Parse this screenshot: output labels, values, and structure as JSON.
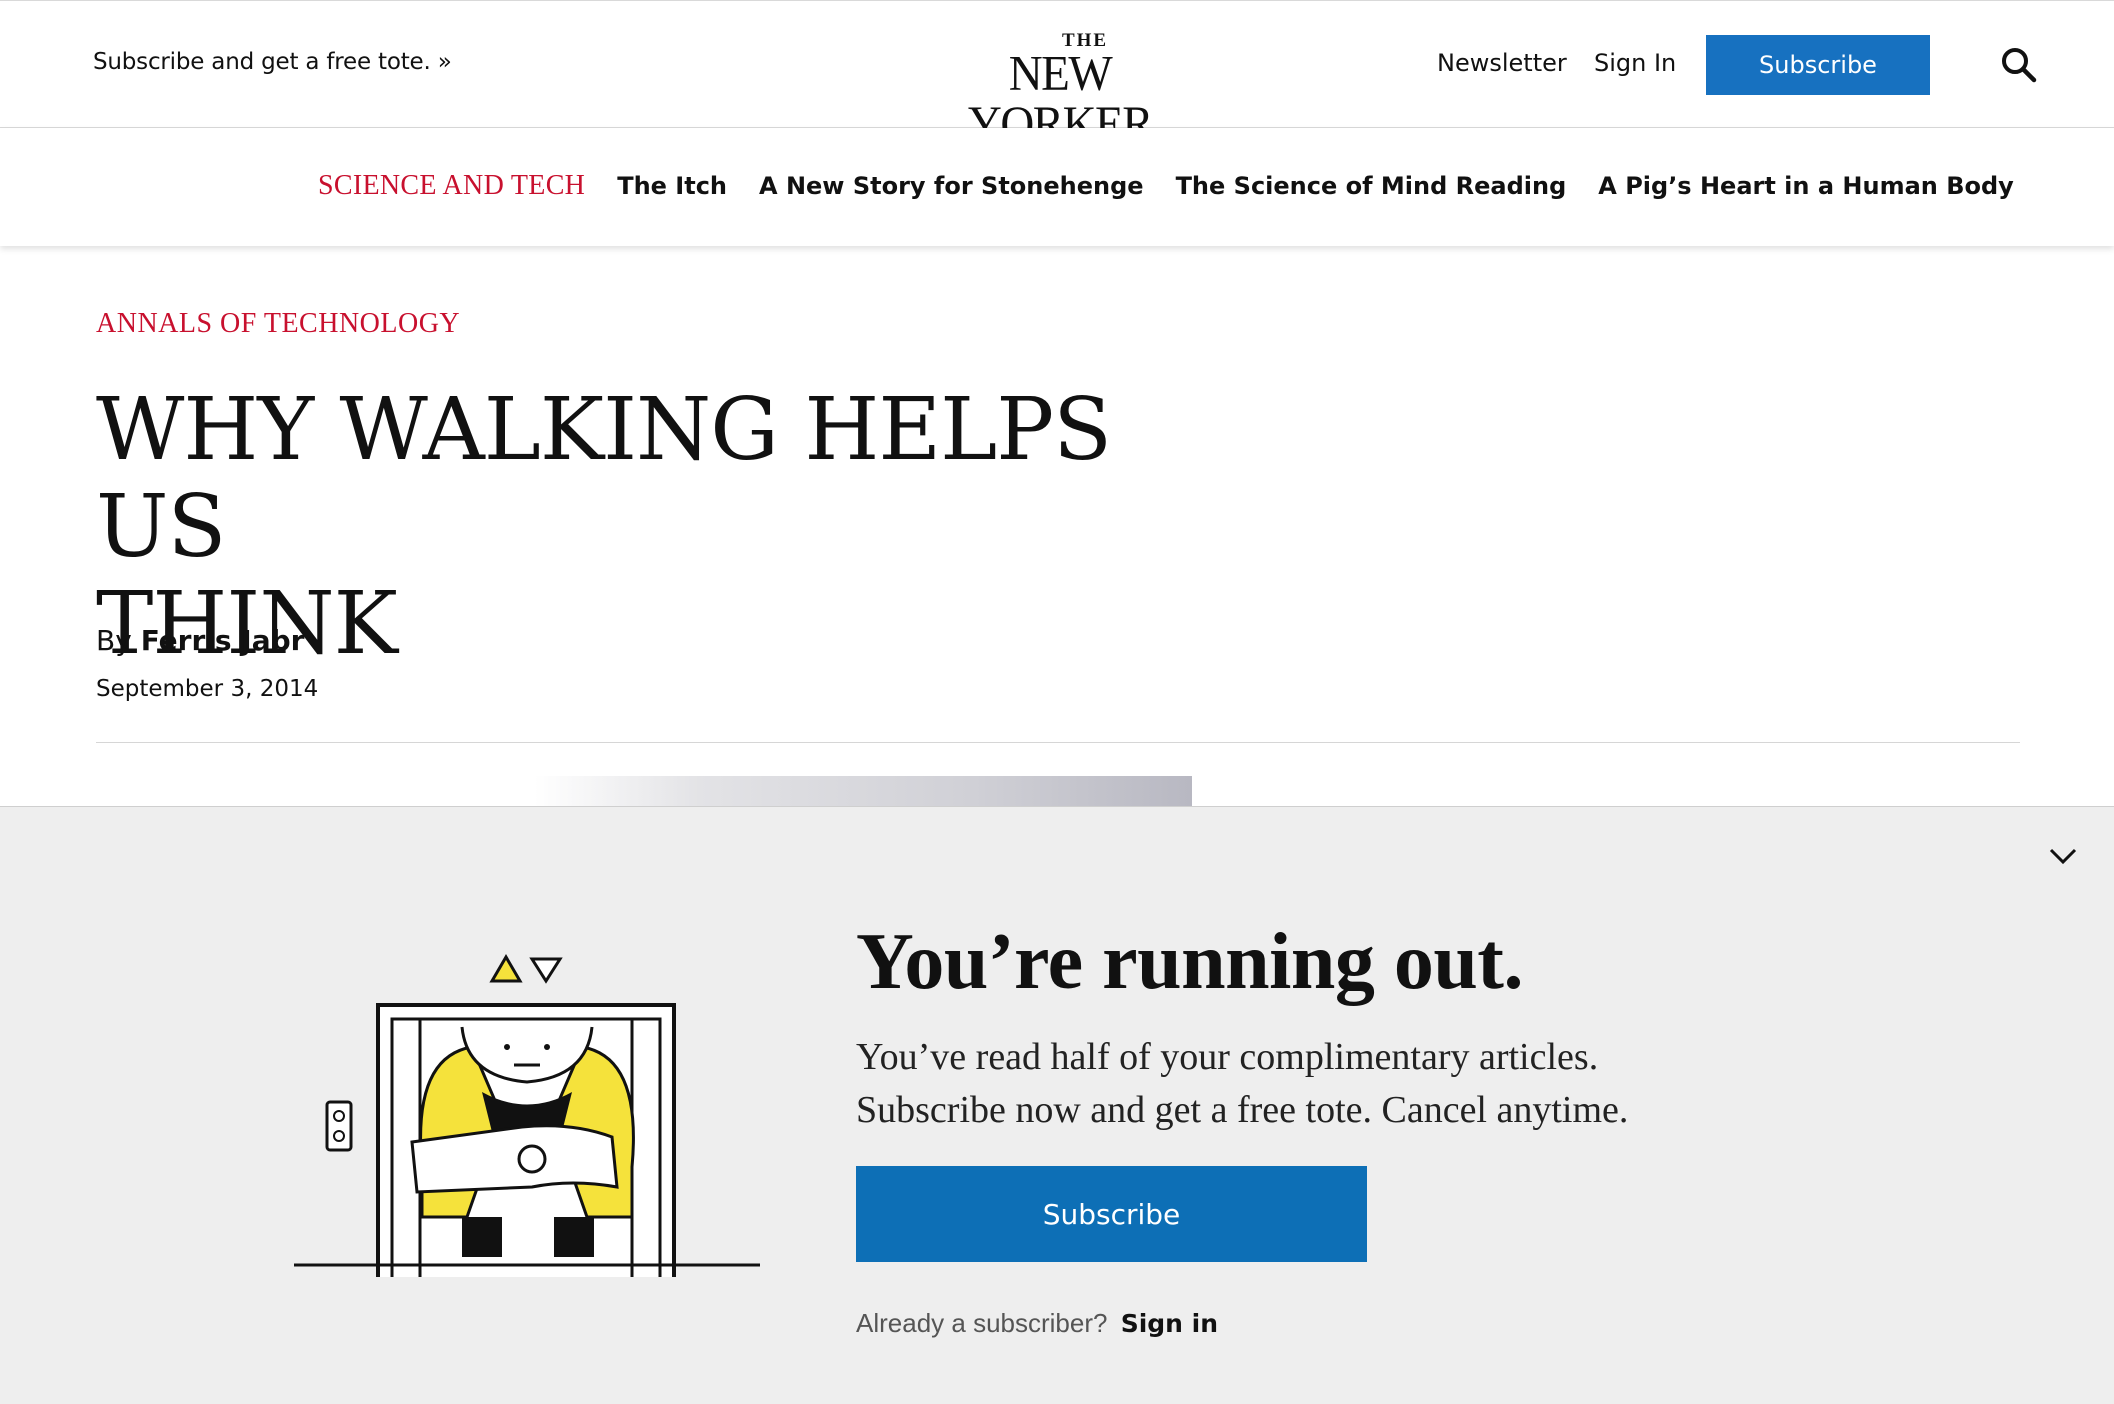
{
  "header": {
    "promo": "Subscribe and get a free tote. »",
    "logo_the": "THE",
    "logo_name": "NEW YORKER",
    "newsletter": "Newsletter",
    "sign_in": "Sign In",
    "subscribe": "Subscribe",
    "search_icon": "search-icon",
    "accent_color": "#1771c0"
  },
  "subnav": {
    "section": "SCIENCE AND TECH",
    "section_color": "#c8102e",
    "links": [
      "The Itch",
      "A New Story for Stonehenge",
      "The Science of Mind Reading",
      "A Pig’s Heart in a Human Body"
    ]
  },
  "article": {
    "rubric": "ANNALS OF TECHNOLOGY",
    "headline_line1": "WHY WALKING HELPS US",
    "headline_line2": "THINK",
    "byline_prefix": "By",
    "author": "Ferris Jabr",
    "date": "September 3, 2014"
  },
  "paywall": {
    "title": "You’re running out.",
    "body_line1": "You’ve read half of your complimentary articles.",
    "body_line2": "Subscribe now and get a free tote. Cancel anytime.",
    "subscribe": "Subscribe",
    "already": "Already a subscriber?",
    "sign_in": "Sign in",
    "collapse_icon": "chevron-down-icon",
    "button_color": "#0d6fb6"
  }
}
